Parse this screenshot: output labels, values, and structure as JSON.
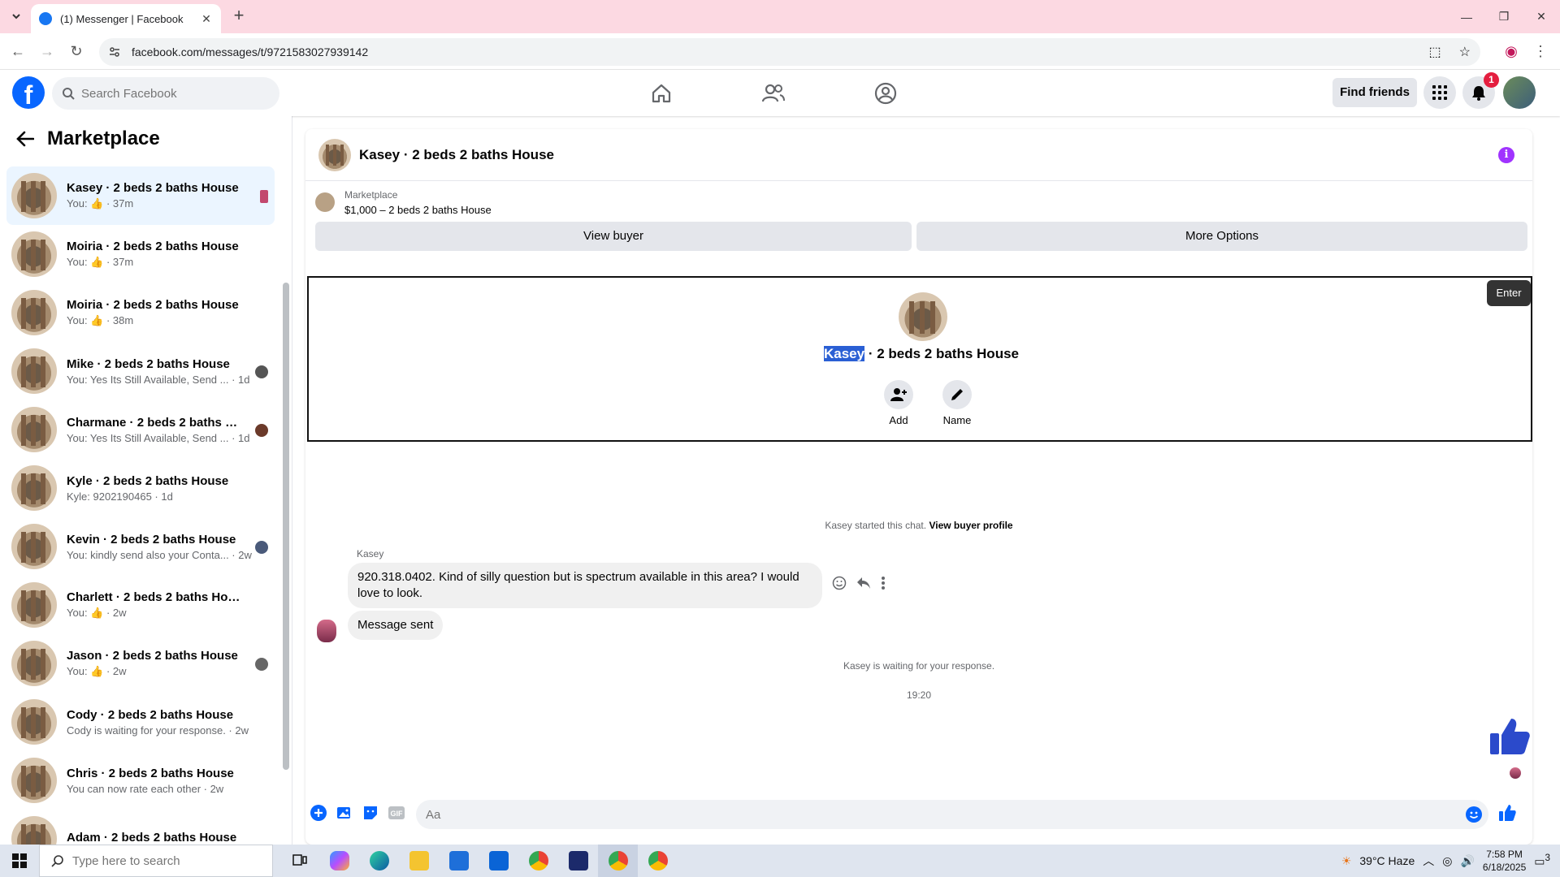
{
  "browser": {
    "tab_title": "(1) Messenger | Facebook",
    "url": "facebook.com/messages/t/9721583027939142"
  },
  "fb": {
    "search_placeholder": "Search Facebook",
    "find_friends": "Find friends",
    "notification_count": "1"
  },
  "sidebar": {
    "title": "Marketplace",
    "conversations": [
      {
        "name": "Kasey · 2 beds 2 baths House",
        "sub": "You: 👍 · 37m",
        "active": true
      },
      {
        "name": "Moiria · 2 beds 2 baths House",
        "sub": "You: 👍 · 37m"
      },
      {
        "name": "Moiria · 2 beds 2 baths House",
        "sub": "You: 👍 · 38m"
      },
      {
        "name": "Mike · 2 beds 2 baths House",
        "sub": "You: Yes Its Still Available, Send ... · 1d"
      },
      {
        "name": "Charmane · 2 beds 2 baths Ho...",
        "sub": "You: Yes Its Still Available, Send ... · 1d"
      },
      {
        "name": "Kyle · 2 beds 2 baths House",
        "sub": "Kyle: 9202190465 · 1d"
      },
      {
        "name": "Kevin · 2 beds 2 baths House",
        "sub": "You: kindly send also your Conta... · 2w"
      },
      {
        "name": "Charlett · 2 beds 2 baths House",
        "sub": "You: 👍 · 2w"
      },
      {
        "name": "Jason · 2 beds 2 baths House",
        "sub": "You: 👍 · 2w"
      },
      {
        "name": "Cody · 2 beds 2 baths House",
        "sub": "Cody is waiting for your response. · 2w"
      },
      {
        "name": "Chris · 2 beds 2 baths House",
        "sub": "You can now rate each other · 2w"
      },
      {
        "name": "Adam · 2 beds 2 baths House",
        "sub": ""
      }
    ]
  },
  "chat": {
    "header_name": "Kasey · 2 beds 2 baths House",
    "listing_label": "Marketplace",
    "listing_price": "$1,000 – 2 beds 2 baths House",
    "view_buyer": "View buyer",
    "more_options": "More Options",
    "profile_first": "Kasey",
    "profile_rest": " · 2 beds 2 baths House",
    "add_label": "Add",
    "name_label": "Name",
    "enter_tooltip": "Enter",
    "started_text": "Kasey started this chat.",
    "view_profile_link": "View buyer profile",
    "sender": "Kasey",
    "message_1": "920.318.0402. Kind of silly question but is spectrum available in this area? I would love to look.",
    "message_2": "Message sent",
    "waiting_text": "Kasey is waiting for your response.",
    "time_stamp": "19:20",
    "composer_placeholder": "Aa"
  },
  "taskbar": {
    "search_placeholder": "Type here to search",
    "weather": "39°C  Haze",
    "time": "7:58 PM",
    "date": "6/18/2025",
    "notif_count": "3"
  }
}
